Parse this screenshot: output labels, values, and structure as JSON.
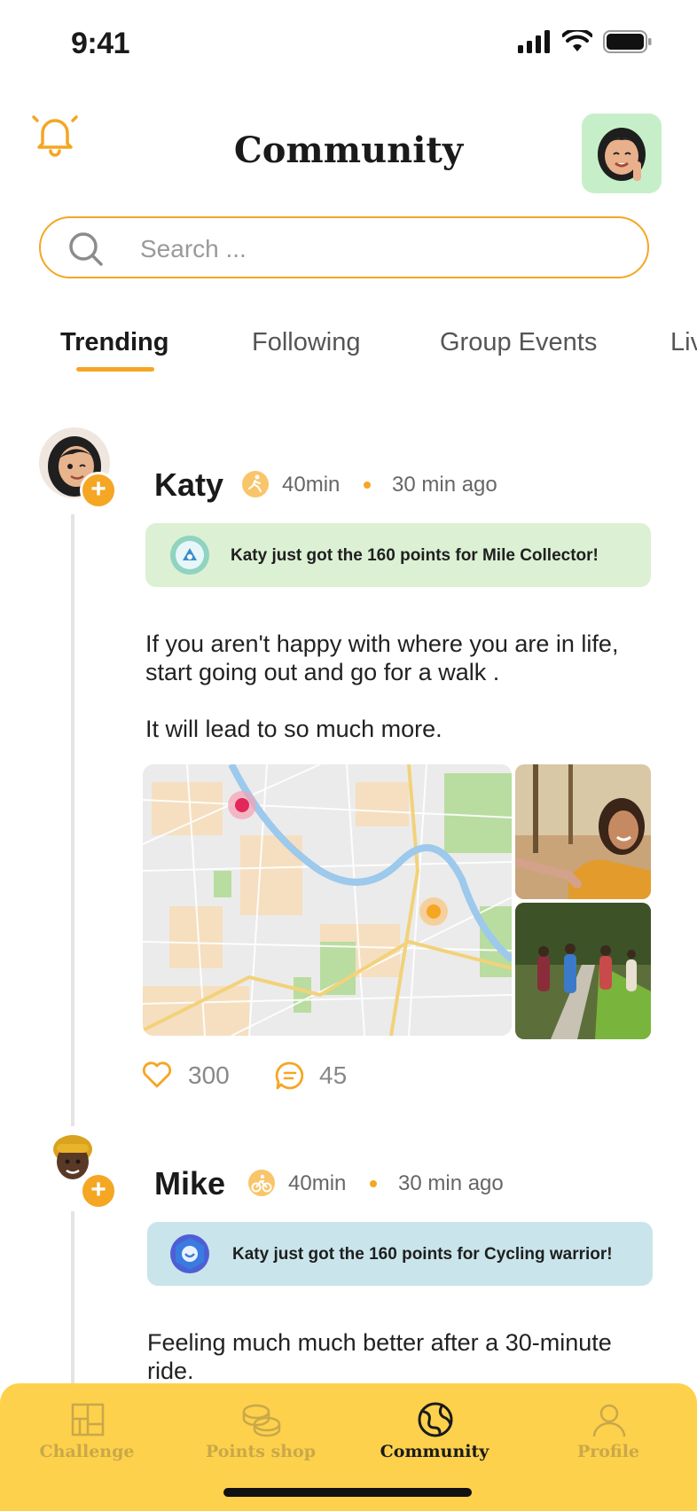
{
  "status_bar": {
    "time": "9:41"
  },
  "header": {
    "title": "Community"
  },
  "search": {
    "placeholder": "Search ..."
  },
  "tabs": [
    {
      "label": "Trending",
      "active": true
    },
    {
      "label": "Following",
      "active": false
    },
    {
      "label": "Group Events",
      "active": false
    },
    {
      "label": "Liv",
      "active": false
    }
  ],
  "posts": [
    {
      "name": "Katy",
      "activity_icon": "running-icon",
      "duration": "40min",
      "time_ago": "30 min ago",
      "banner": {
        "text": "Katy just  got the 160 points for Mile Collector!",
        "color": "#dcf0d4"
      },
      "text_lines": [
        "If you aren't happy with where you are in life,",
        "start going out and go for a walk .",
        "",
        "It will lead to so much more."
      ],
      "likes": "300",
      "comments": "45"
    },
    {
      "name": "Mike",
      "activity_icon": "cycling-icon",
      "duration": "40min",
      "time_ago": "30 min ago",
      "banner": {
        "text": "Katy just  got the 160 points for Cycling warrior!",
        "color": "#c9e5eb"
      },
      "text_lines": [
        "Feeling much much better after a 30-minute",
        "ride."
      ]
    }
  ],
  "bottom_nav": [
    {
      "label": "Challenge",
      "icon": "grid-icon",
      "active": false
    },
    {
      "label": "Points shop",
      "icon": "coins-icon",
      "active": false
    },
    {
      "label": "Community",
      "icon": "globe-icon",
      "active": true
    },
    {
      "label": "Profile",
      "icon": "person-icon",
      "active": false
    }
  ],
  "colors": {
    "accent": "#f5a623",
    "nav_bg": "#fdd14b"
  }
}
